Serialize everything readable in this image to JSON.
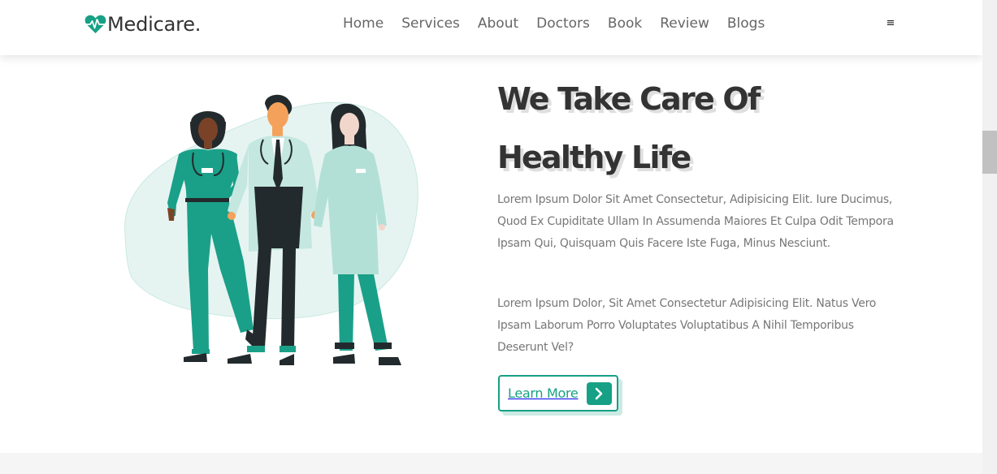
{
  "header": {
    "logo_text": "Medicare.",
    "logo_icon": "heartbeat-icon",
    "nav": [
      "Home",
      "Services",
      "About",
      "Doctors",
      "Book",
      "Review",
      "Blogs"
    ],
    "menu_icon": "≡"
  },
  "hero": {
    "heading_line1": "We Take Care Of",
    "heading_line2": "Healthy Life",
    "paragraph1": "Lorem Ipsum Dolor Sit Amet Consectetur, Adipisicing Elit. Iure Ducimus, Quod Ex Cupiditate Ullam In Assumenda Maiores Et Culpa Odit Tempora Ipsam Qui, Quisquam Quis Facere Iste Fuga, Minus Nesciunt.",
    "paragraph2": "Lorem Ipsum Dolor, Sit Amet Consectetur Adipisicing Elit. Natus Vero Ipsam Laborum Porro Voluptates Voluptatibus A Nihil Temporibus Deserunt Vel?",
    "button_label": "Learn More",
    "button_icon": "chevron-right-icon",
    "illustration": "doctors-illustration"
  },
  "colors": {
    "accent": "#16a085",
    "heading": "#333333",
    "body_text": "#777777"
  }
}
